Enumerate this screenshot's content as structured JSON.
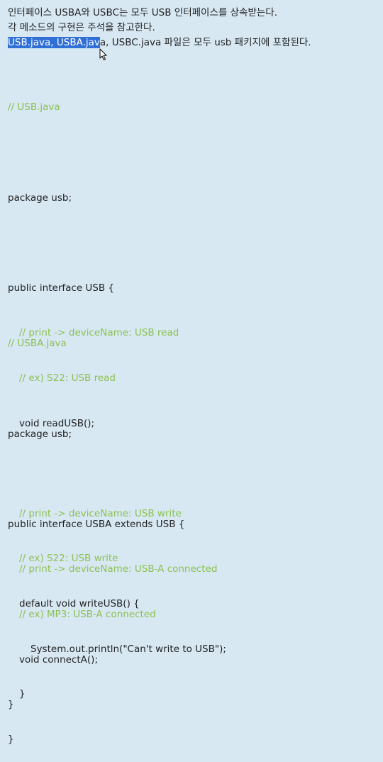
{
  "intro": {
    "line1": "인터페이스 USBA와 USBC는 모두 USB 인터페이스를 상속받는다.",
    "line2": "각 메소드의 구현은 주석을 참고한다.",
    "line3_selected": "USB.java, USBA.jav",
    "line3_rest": "a, USBC.java 파일은 모두 usb 패키지에 포함된다."
  },
  "usb_file": {
    "header_comment": "// USB.java",
    "package": "package usb;",
    "interface_decl": "public interface USB {",
    "c1": "// print -> deviceName: USB read",
    "c2": "// ex) S22: USB read",
    "m1": "void readUSB();",
    "c3": "// print -> deviceName: USB write",
    "c4": "// ex) S22: USB write",
    "m2": "default void writeUSB() {",
    "m2_body": "System.out.println(\"Can't write to USB\");",
    "m2_close": "}",
    "close": "}"
  },
  "usba_file": {
    "header_comment": "// USBA.java",
    "package": "package usb;",
    "interface_decl": "public interface USBA extends USB {",
    "c1": "// print -> deviceName: USB-A connected",
    "c2": "// ex) MP3: USB-A connected",
    "m1": "void connectA();",
    "close": "}"
  },
  "colors": {
    "background": "#d7e8f3",
    "comment": "#8cc152",
    "selection": "#2f6fd6"
  }
}
